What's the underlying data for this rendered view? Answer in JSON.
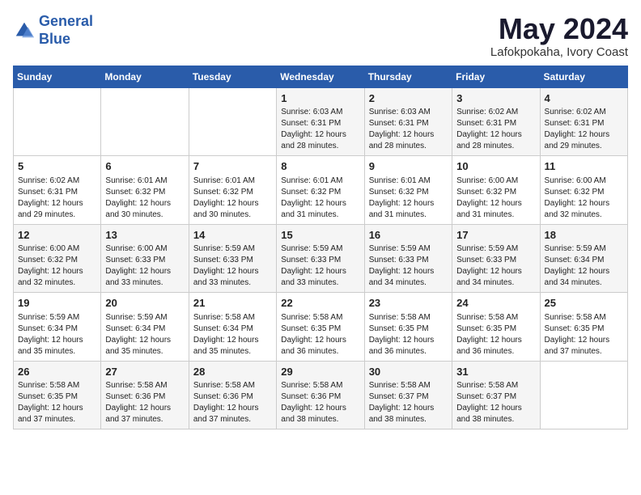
{
  "logo": {
    "line1": "General",
    "line2": "Blue"
  },
  "header": {
    "month": "May 2024",
    "location": "Lafokpokaha, Ivory Coast"
  },
  "weekdays": [
    "Sunday",
    "Monday",
    "Tuesday",
    "Wednesday",
    "Thursday",
    "Friday",
    "Saturday"
  ],
  "weeks": [
    [
      {
        "day": "",
        "info": ""
      },
      {
        "day": "",
        "info": ""
      },
      {
        "day": "",
        "info": ""
      },
      {
        "day": "1",
        "info": "Sunrise: 6:03 AM\nSunset: 6:31 PM\nDaylight: 12 hours\nand 28 minutes."
      },
      {
        "day": "2",
        "info": "Sunrise: 6:03 AM\nSunset: 6:31 PM\nDaylight: 12 hours\nand 28 minutes."
      },
      {
        "day": "3",
        "info": "Sunrise: 6:02 AM\nSunset: 6:31 PM\nDaylight: 12 hours\nand 28 minutes."
      },
      {
        "day": "4",
        "info": "Sunrise: 6:02 AM\nSunset: 6:31 PM\nDaylight: 12 hours\nand 29 minutes."
      }
    ],
    [
      {
        "day": "5",
        "info": "Sunrise: 6:02 AM\nSunset: 6:31 PM\nDaylight: 12 hours\nand 29 minutes."
      },
      {
        "day": "6",
        "info": "Sunrise: 6:01 AM\nSunset: 6:32 PM\nDaylight: 12 hours\nand 30 minutes."
      },
      {
        "day": "7",
        "info": "Sunrise: 6:01 AM\nSunset: 6:32 PM\nDaylight: 12 hours\nand 30 minutes."
      },
      {
        "day": "8",
        "info": "Sunrise: 6:01 AM\nSunset: 6:32 PM\nDaylight: 12 hours\nand 31 minutes."
      },
      {
        "day": "9",
        "info": "Sunrise: 6:01 AM\nSunset: 6:32 PM\nDaylight: 12 hours\nand 31 minutes."
      },
      {
        "day": "10",
        "info": "Sunrise: 6:00 AM\nSunset: 6:32 PM\nDaylight: 12 hours\nand 31 minutes."
      },
      {
        "day": "11",
        "info": "Sunrise: 6:00 AM\nSunset: 6:32 PM\nDaylight: 12 hours\nand 32 minutes."
      }
    ],
    [
      {
        "day": "12",
        "info": "Sunrise: 6:00 AM\nSunset: 6:32 PM\nDaylight: 12 hours\nand 32 minutes."
      },
      {
        "day": "13",
        "info": "Sunrise: 6:00 AM\nSunset: 6:33 PM\nDaylight: 12 hours\nand 33 minutes."
      },
      {
        "day": "14",
        "info": "Sunrise: 5:59 AM\nSunset: 6:33 PM\nDaylight: 12 hours\nand 33 minutes."
      },
      {
        "day": "15",
        "info": "Sunrise: 5:59 AM\nSunset: 6:33 PM\nDaylight: 12 hours\nand 33 minutes."
      },
      {
        "day": "16",
        "info": "Sunrise: 5:59 AM\nSunset: 6:33 PM\nDaylight: 12 hours\nand 34 minutes."
      },
      {
        "day": "17",
        "info": "Sunrise: 5:59 AM\nSunset: 6:33 PM\nDaylight: 12 hours\nand 34 minutes."
      },
      {
        "day": "18",
        "info": "Sunrise: 5:59 AM\nSunset: 6:34 PM\nDaylight: 12 hours\nand 34 minutes."
      }
    ],
    [
      {
        "day": "19",
        "info": "Sunrise: 5:59 AM\nSunset: 6:34 PM\nDaylight: 12 hours\nand 35 minutes."
      },
      {
        "day": "20",
        "info": "Sunrise: 5:59 AM\nSunset: 6:34 PM\nDaylight: 12 hours\nand 35 minutes."
      },
      {
        "day": "21",
        "info": "Sunrise: 5:58 AM\nSunset: 6:34 PM\nDaylight: 12 hours\nand 35 minutes."
      },
      {
        "day": "22",
        "info": "Sunrise: 5:58 AM\nSunset: 6:35 PM\nDaylight: 12 hours\nand 36 minutes."
      },
      {
        "day": "23",
        "info": "Sunrise: 5:58 AM\nSunset: 6:35 PM\nDaylight: 12 hours\nand 36 minutes."
      },
      {
        "day": "24",
        "info": "Sunrise: 5:58 AM\nSunset: 6:35 PM\nDaylight: 12 hours\nand 36 minutes."
      },
      {
        "day": "25",
        "info": "Sunrise: 5:58 AM\nSunset: 6:35 PM\nDaylight: 12 hours\nand 37 minutes."
      }
    ],
    [
      {
        "day": "26",
        "info": "Sunrise: 5:58 AM\nSunset: 6:35 PM\nDaylight: 12 hours\nand 37 minutes."
      },
      {
        "day": "27",
        "info": "Sunrise: 5:58 AM\nSunset: 6:36 PM\nDaylight: 12 hours\nand 37 minutes."
      },
      {
        "day": "28",
        "info": "Sunrise: 5:58 AM\nSunset: 6:36 PM\nDaylight: 12 hours\nand 37 minutes."
      },
      {
        "day": "29",
        "info": "Sunrise: 5:58 AM\nSunset: 6:36 PM\nDaylight: 12 hours\nand 38 minutes."
      },
      {
        "day": "30",
        "info": "Sunrise: 5:58 AM\nSunset: 6:37 PM\nDaylight: 12 hours\nand 38 minutes."
      },
      {
        "day": "31",
        "info": "Sunrise: 5:58 AM\nSunset: 6:37 PM\nDaylight: 12 hours\nand 38 minutes."
      },
      {
        "day": "",
        "info": ""
      }
    ]
  ]
}
